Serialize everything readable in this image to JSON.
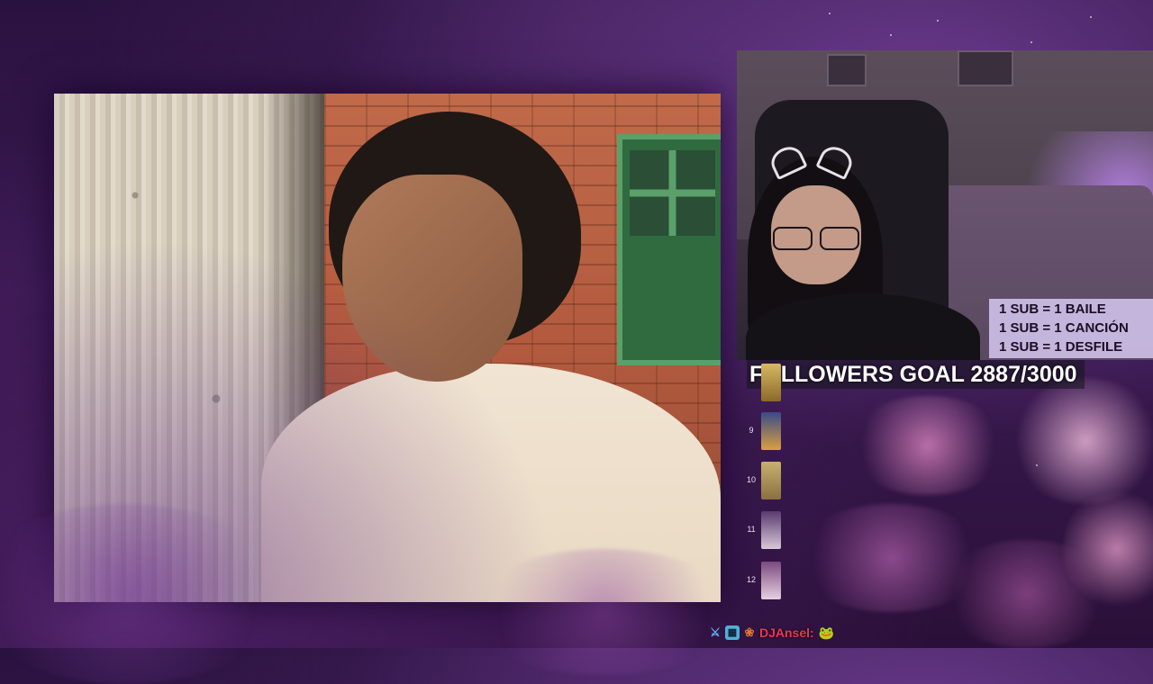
{
  "sub_rules": {
    "lines": [
      "1 SUB = 1 BAILE",
      "1 SUB = 1 CANCIÓN",
      "1 SUB = 1 DESFILE"
    ]
  },
  "followers_goal": {
    "label": "FOLLOWERS GOAL 2887/3000"
  },
  "playlist": {
    "numbers": [
      "9",
      "10",
      "11",
      "12"
    ]
  },
  "chat": {
    "username": "DJAnsel:",
    "message": "🐸",
    "badge_icons": [
      "sword-icon",
      "grid-badge-icon",
      "paw-icon"
    ]
  },
  "colors": {
    "sub_rules_bg": "#cdbee6",
    "chat_username": "#e53a52"
  }
}
